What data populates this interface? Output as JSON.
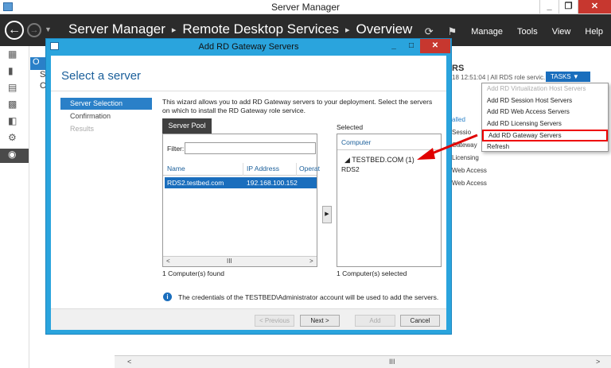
{
  "window": {
    "title": "Server Manager"
  },
  "header": {
    "breadcrumb": [
      "Server Manager",
      "Remote Desktop Services",
      "Overview"
    ],
    "menu": [
      "Manage",
      "Tools",
      "View",
      "Help"
    ]
  },
  "background": {
    "left_col": [
      "O",
      "S",
      "C"
    ],
    "right_panel": {
      "title": "RS",
      "subtitle": "18 12:51:04 | All RDS role servic...",
      "tasks_label": "TASKS",
      "list": [
        "alled",
        "Sessio",
        "Gateway",
        "Licensing",
        "Web Access",
        "Web Access"
      ]
    },
    "dropdown": [
      {
        "label": "Add RD Virtualization Host Servers",
        "disabled": true
      },
      {
        "label": "Add RD Session Host Servers",
        "disabled": false
      },
      {
        "label": "Add RD Web Access Servers",
        "disabled": false
      },
      {
        "label": "Add RD Licensing Servers",
        "disabled": false
      },
      {
        "label": "Add RD Gateway Servers",
        "disabled": false,
        "highlighted": true
      },
      {
        "label": "Refresh",
        "disabled": false
      }
    ],
    "bottom_scroll": {
      "left": "<",
      "mid": "III",
      "right": ">"
    }
  },
  "dialog": {
    "title": "Add RD Gateway Servers",
    "heading": "Select a server",
    "steps": [
      {
        "label": "Server Selection",
        "state": "current"
      },
      {
        "label": "Confirmation",
        "state": "normal"
      },
      {
        "label": "Results",
        "state": "disabled"
      }
    ],
    "intro": "This wizard allows you to add RD Gateway servers to your deployment. Select the servers on which to install the RD Gateway role service.",
    "pool_tab": "Server Pool",
    "filter_label": "Filter:",
    "filter_value": "",
    "columns": [
      "Name",
      "IP Address",
      "Operat"
    ],
    "rows": [
      {
        "name": "RDS2.testbed.com",
        "ip": "192.168.100.152"
      }
    ],
    "scroll": {
      "left": "<",
      "mid": "III",
      "right": ">"
    },
    "found_text": "1 Computer(s) found",
    "selected_label": "Selected",
    "selected_column": "Computer",
    "selected_group": "TESTBED.COM (1)",
    "selected_item": "RDS2",
    "selected_count": "1 Computer(s) selected",
    "info_text": "The credentials of the TESTBED\\Administrator account will be used to add the servers.",
    "buttons": {
      "previous": "< Previous",
      "next": "Next >",
      "add": "Add",
      "cancel": "Cancel"
    }
  },
  "colors": {
    "accent": "#2a80c8",
    "dialog_frame": "#2aa4dd",
    "header": "#2b2b2b",
    "callout": "#e00000"
  }
}
